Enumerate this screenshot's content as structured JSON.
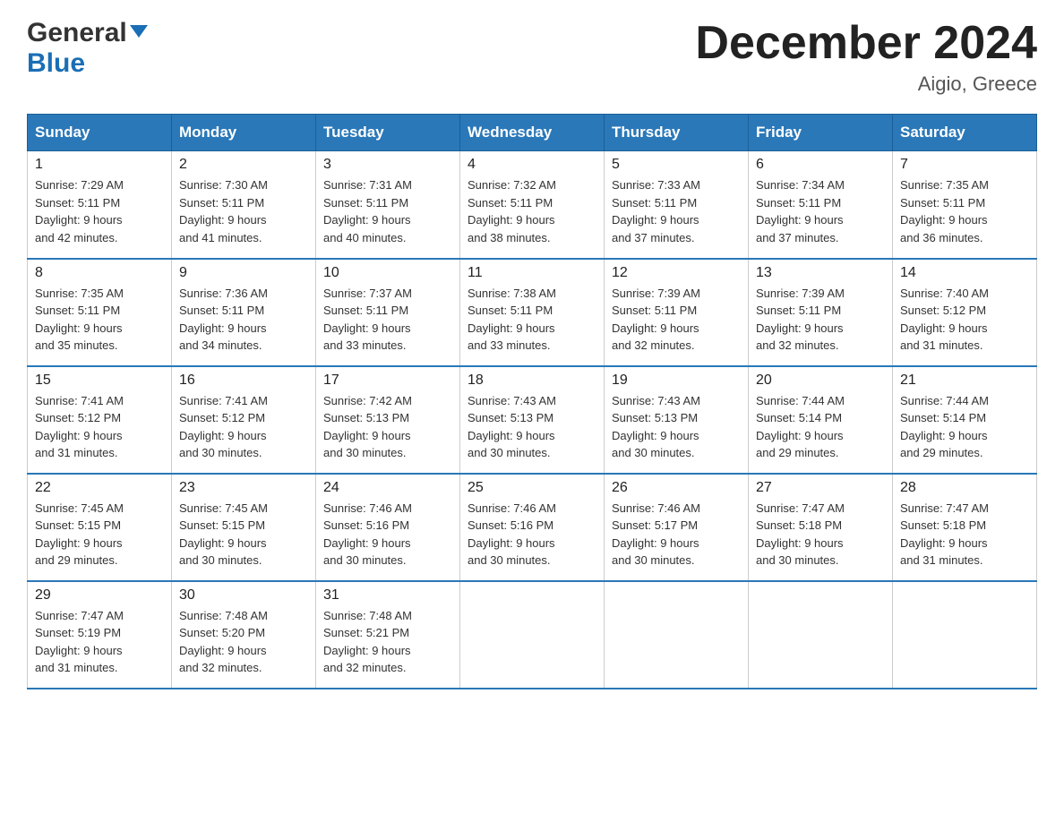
{
  "logo": {
    "general": "General",
    "blue": "Blue"
  },
  "title": "December 2024",
  "subtitle": "Aigio, Greece",
  "days_of_week": [
    "Sunday",
    "Monday",
    "Tuesday",
    "Wednesday",
    "Thursday",
    "Friday",
    "Saturday"
  ],
  "weeks": [
    [
      {
        "day": "1",
        "sunrise": "7:29 AM",
        "sunset": "5:11 PM",
        "daylight": "9 hours and 42 minutes."
      },
      {
        "day": "2",
        "sunrise": "7:30 AM",
        "sunset": "5:11 PM",
        "daylight": "9 hours and 41 minutes."
      },
      {
        "day": "3",
        "sunrise": "7:31 AM",
        "sunset": "5:11 PM",
        "daylight": "9 hours and 40 minutes."
      },
      {
        "day": "4",
        "sunrise": "7:32 AM",
        "sunset": "5:11 PM",
        "daylight": "9 hours and 38 minutes."
      },
      {
        "day": "5",
        "sunrise": "7:33 AM",
        "sunset": "5:11 PM",
        "daylight": "9 hours and 37 minutes."
      },
      {
        "day": "6",
        "sunrise": "7:34 AM",
        "sunset": "5:11 PM",
        "daylight": "9 hours and 37 minutes."
      },
      {
        "day": "7",
        "sunrise": "7:35 AM",
        "sunset": "5:11 PM",
        "daylight": "9 hours and 36 minutes."
      }
    ],
    [
      {
        "day": "8",
        "sunrise": "7:35 AM",
        "sunset": "5:11 PM",
        "daylight": "9 hours and 35 minutes."
      },
      {
        "day": "9",
        "sunrise": "7:36 AM",
        "sunset": "5:11 PM",
        "daylight": "9 hours and 34 minutes."
      },
      {
        "day": "10",
        "sunrise": "7:37 AM",
        "sunset": "5:11 PM",
        "daylight": "9 hours and 33 minutes."
      },
      {
        "day": "11",
        "sunrise": "7:38 AM",
        "sunset": "5:11 PM",
        "daylight": "9 hours and 33 minutes."
      },
      {
        "day": "12",
        "sunrise": "7:39 AM",
        "sunset": "5:11 PM",
        "daylight": "9 hours and 32 minutes."
      },
      {
        "day": "13",
        "sunrise": "7:39 AM",
        "sunset": "5:11 PM",
        "daylight": "9 hours and 32 minutes."
      },
      {
        "day": "14",
        "sunrise": "7:40 AM",
        "sunset": "5:12 PM",
        "daylight": "9 hours and 31 minutes."
      }
    ],
    [
      {
        "day": "15",
        "sunrise": "7:41 AM",
        "sunset": "5:12 PM",
        "daylight": "9 hours and 31 minutes."
      },
      {
        "day": "16",
        "sunrise": "7:41 AM",
        "sunset": "5:12 PM",
        "daylight": "9 hours and 30 minutes."
      },
      {
        "day": "17",
        "sunrise": "7:42 AM",
        "sunset": "5:13 PM",
        "daylight": "9 hours and 30 minutes."
      },
      {
        "day": "18",
        "sunrise": "7:43 AM",
        "sunset": "5:13 PM",
        "daylight": "9 hours and 30 minutes."
      },
      {
        "day": "19",
        "sunrise": "7:43 AM",
        "sunset": "5:13 PM",
        "daylight": "9 hours and 30 minutes."
      },
      {
        "day": "20",
        "sunrise": "7:44 AM",
        "sunset": "5:14 PM",
        "daylight": "9 hours and 29 minutes."
      },
      {
        "day": "21",
        "sunrise": "7:44 AM",
        "sunset": "5:14 PM",
        "daylight": "9 hours and 29 minutes."
      }
    ],
    [
      {
        "day": "22",
        "sunrise": "7:45 AM",
        "sunset": "5:15 PM",
        "daylight": "9 hours and 29 minutes."
      },
      {
        "day": "23",
        "sunrise": "7:45 AM",
        "sunset": "5:15 PM",
        "daylight": "9 hours and 30 minutes."
      },
      {
        "day": "24",
        "sunrise": "7:46 AM",
        "sunset": "5:16 PM",
        "daylight": "9 hours and 30 minutes."
      },
      {
        "day": "25",
        "sunrise": "7:46 AM",
        "sunset": "5:16 PM",
        "daylight": "9 hours and 30 minutes."
      },
      {
        "day": "26",
        "sunrise": "7:46 AM",
        "sunset": "5:17 PM",
        "daylight": "9 hours and 30 minutes."
      },
      {
        "day": "27",
        "sunrise": "7:47 AM",
        "sunset": "5:18 PM",
        "daylight": "9 hours and 30 minutes."
      },
      {
        "day": "28",
        "sunrise": "7:47 AM",
        "sunset": "5:18 PM",
        "daylight": "9 hours and 31 minutes."
      }
    ],
    [
      {
        "day": "29",
        "sunrise": "7:47 AM",
        "sunset": "5:19 PM",
        "daylight": "9 hours and 31 minutes."
      },
      {
        "day": "30",
        "sunrise": "7:48 AM",
        "sunset": "5:20 PM",
        "daylight": "9 hours and 32 minutes."
      },
      {
        "day": "31",
        "sunrise": "7:48 AM",
        "sunset": "5:21 PM",
        "daylight": "9 hours and 32 minutes."
      },
      null,
      null,
      null,
      null
    ]
  ],
  "labels": {
    "sunrise": "Sunrise:",
    "sunset": "Sunset:",
    "daylight": "Daylight:"
  }
}
